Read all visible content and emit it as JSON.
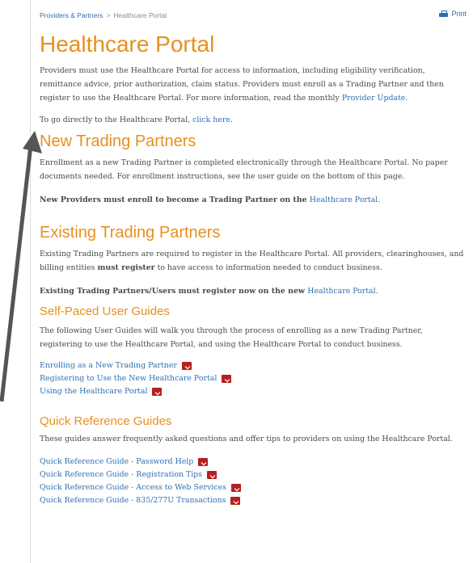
{
  "breadcrumb": {
    "parent": "Providers & Partners",
    "separator": ">",
    "current": "Healthcare Portal"
  },
  "toolbar": {
    "print_label": "Print"
  },
  "page": {
    "title": "Healthcare Portal",
    "intro_text": "Providers must use the Healthcare Portal for access to information, including eligibility verification, remittance advice, prior authorization, claim status.   Providers must enroll as a Trading Partner and then register to use the Healthcare Portal.  For more information, read the monthly ",
    "intro_link": "Provider Update",
    "intro_end": ".",
    "direct_text": "To go directly to the Healthcare Portal, ",
    "direct_link": "click here",
    "direct_end": "."
  },
  "new_partners": {
    "heading": "New Trading Partners",
    "text": "Enrollment as a new Trading Partner is completed electronically through the Healthcare Portal. No paper documents needed.  For enrollment instructions, see the user guide on the bottom of this page.",
    "cta_bold": "New Providers must enroll to become a Trading Partner on the ",
    "cta_link": "Healthcare Portal",
    "cta_end": "."
  },
  "existing_partners": {
    "heading": "Existing Trading Partners",
    "text_a": "Existing Trading Partners are required to register in the Healthcare Portal.  All providers, clearinghouses, and billing entities ",
    "text_bold": "must register",
    "text_b": " to have access to information needed to conduct business.",
    "cta_bold": "Existing Trading Partners/Users must register now on the new ",
    "cta_link": "Healthcare Portal",
    "cta_end": "."
  },
  "user_guides": {
    "heading": "Self-Paced User Guides",
    "text": "The following User Guides will walk you through the process of enrolling as a new Trading Partner, registering to use the Healthcare Portal, and using the Healthcare Portal to conduct business.",
    "items": [
      {
        "label": "Enrolling as a New Trading Partner"
      },
      {
        "label": "Registering to Use the New Healthcare Portal"
      },
      {
        "label": "Using the Healthcare Portal"
      }
    ]
  },
  "quick_guides": {
    "heading": "Quick Reference Guides",
    "text": "These guides answer frequently asked questions and offer tips to providers on using the Healthcare Portal.",
    "items": [
      {
        "label": "Quick Reference Guide - Password Help"
      },
      {
        "label": "Quick Reference Guide - Registration Tips"
      },
      {
        "label": "Quick Reference Guide - Access to Web Services"
      },
      {
        "label": "Quick Reference Guide - 835/277U Transactions"
      }
    ]
  },
  "colors": {
    "heading": "#e8901e",
    "link": "#2f6fb3",
    "annotation_arrow": "#555555",
    "pdf_icon": "#b51f1f"
  }
}
